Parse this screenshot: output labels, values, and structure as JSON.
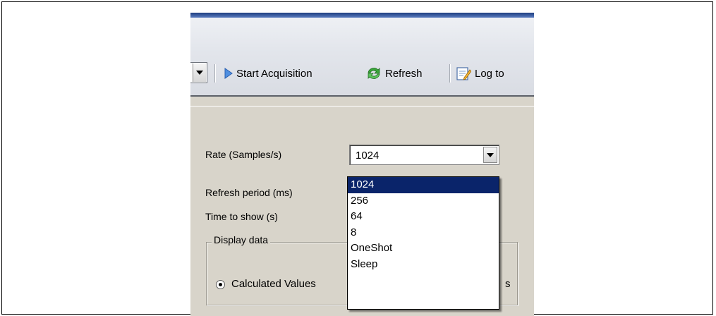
{
  "toolbar": {
    "start_acquisition_label": "Start Acquisition",
    "refresh_label": "Refresh",
    "log_label": "Log to",
    "icons": [
      "play-icon",
      "refresh-icon",
      "log-icon"
    ]
  },
  "settings": {
    "rate_label": "Rate (Samples/s)",
    "rate_value": "1024",
    "refresh_period_label": "Refresh period (ms)",
    "time_to_show_label": "Time to show (s)"
  },
  "display_data": {
    "title": "Display data",
    "calculated_values_label": "Calculated Values",
    "second_option_tail": "s"
  },
  "rate_dropdown": {
    "options": [
      "1024",
      "256",
      "64",
      "8",
      "OneShot",
      "Sleep"
    ],
    "selected_index": 0
  },
  "colors": {
    "selection": "#0a246a",
    "panel": "#d8d4ca",
    "title_bar": "#1f3d80"
  }
}
